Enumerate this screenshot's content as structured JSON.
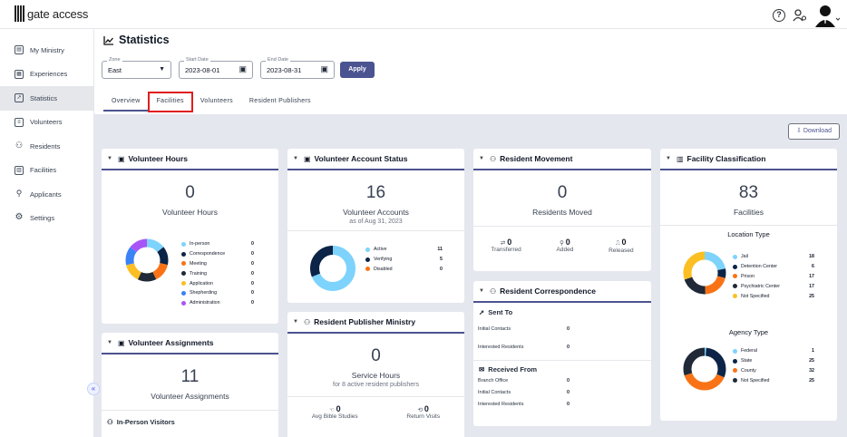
{
  "app": {
    "logo_text": "gate access"
  },
  "sidebar": {
    "items": [
      {
        "label": "My Ministry",
        "icon": "ministry-icon"
      },
      {
        "label": "Experiences",
        "icon": "calendar-icon"
      },
      {
        "label": "Statistics",
        "icon": "chart-icon",
        "active": true
      },
      {
        "label": "Volunteers",
        "icon": "badge-icon"
      },
      {
        "label": "Residents",
        "icon": "people-icon"
      },
      {
        "label": "Facilities",
        "icon": "building-icon"
      },
      {
        "label": "Applicants",
        "icon": "user-edit-icon"
      },
      {
        "label": "Settings",
        "icon": "gear-icon"
      }
    ]
  },
  "header": {
    "title": "Statistics",
    "zone_label": "Zone",
    "zone_value": "East",
    "start_label": "Start Date",
    "start_value": "2023-08-01",
    "end_label": "End Date",
    "end_value": "2023-08-31",
    "apply_label": "Apply",
    "tabs": [
      "Overview",
      "Facilities",
      "Volunteers",
      "Resident Publishers"
    ]
  },
  "download_label": "Download",
  "volunteer_hours": {
    "title": "Volunteer Hours",
    "value": "0",
    "label": "Volunteer Hours",
    "legend": [
      {
        "name": "In-person",
        "value": "0",
        "color": "#7dd3fc"
      },
      {
        "name": "Correspondence",
        "value": "0",
        "color": "#0b2447"
      },
      {
        "name": "Meeting",
        "value": "0",
        "color": "#f97316"
      },
      {
        "name": "Training",
        "value": "0",
        "color": "#1f2937"
      },
      {
        "name": "Application",
        "value": "0",
        "color": "#fbbf24"
      },
      {
        "name": "Shepherding",
        "value": "0",
        "color": "#3b82f6"
      },
      {
        "name": "Administration",
        "value": "0",
        "color": "#a855f7"
      }
    ]
  },
  "volunteer_assignments": {
    "title": "Volunteer Assignments",
    "value": "11",
    "label": "Volunteer Assignments",
    "section": "In-Person Visitors"
  },
  "volunteer_account_status": {
    "title": "Volunteer Account Status",
    "value": "16",
    "label": "Volunteer Accounts",
    "sub": "as of Aug 31, 2023",
    "legend": [
      {
        "name": "Active",
        "value": "11",
        "color": "#7dd3fc"
      },
      {
        "name": "Verifying",
        "value": "5",
        "color": "#0b2447"
      },
      {
        "name": "Disabled",
        "value": "0",
        "color": "#f97316"
      }
    ]
  },
  "resident_publisher_ministry": {
    "title": "Resident Publisher Ministry",
    "value": "0",
    "label": "Service Hours",
    "sub": "for 8 active resident publishers",
    "stats": [
      {
        "value": "0",
        "label": "Avg Bible Studies"
      },
      {
        "value": "0",
        "label": "Return Visits"
      }
    ]
  },
  "resident_movement": {
    "title": "Resident Movement",
    "value": "0",
    "label": "Residents Moved",
    "stats": [
      {
        "value": "0",
        "label": "Transferred"
      },
      {
        "value": "0",
        "label": "Added"
      },
      {
        "value": "0",
        "label": "Released"
      }
    ]
  },
  "resident_correspondence": {
    "title": "Resident Correspondence",
    "sent_to": "Sent To",
    "sent_rows": [
      {
        "k": "Initial Contacts",
        "v": "0"
      },
      {
        "k": "Interested Residents",
        "v": "0"
      }
    ],
    "received_from": "Received From",
    "received_rows": [
      {
        "k": "Branch Office",
        "v": "0"
      },
      {
        "k": "Initial Contacts",
        "v": "0"
      },
      {
        "k": "Interested Residents",
        "v": "0"
      }
    ]
  },
  "facility_classification": {
    "title": "Facility Classification",
    "value": "83",
    "label": "Facilities",
    "location_title": "Location Type",
    "location_legend": [
      {
        "name": "Jail",
        "value": "18",
        "color": "#7dd3fc"
      },
      {
        "name": "Detention Center",
        "value": "6",
        "color": "#0b2447"
      },
      {
        "name": "Prison",
        "value": "17",
        "color": "#f97316"
      },
      {
        "name": "Psychiatric Center",
        "value": "17",
        "color": "#1f2937"
      },
      {
        "name": "Not Specified",
        "value": "25",
        "color": "#fbbf24"
      }
    ],
    "agency_title": "Agency Type",
    "agency_legend": [
      {
        "name": "Federal",
        "value": "1",
        "color": "#7dd3fc"
      },
      {
        "name": "State",
        "value": "25",
        "color": "#0b2447"
      },
      {
        "name": "County",
        "value": "32",
        "color": "#f97316"
      },
      {
        "name": "Not Specified",
        "value": "25",
        "color": "#1f2937"
      }
    ]
  }
}
